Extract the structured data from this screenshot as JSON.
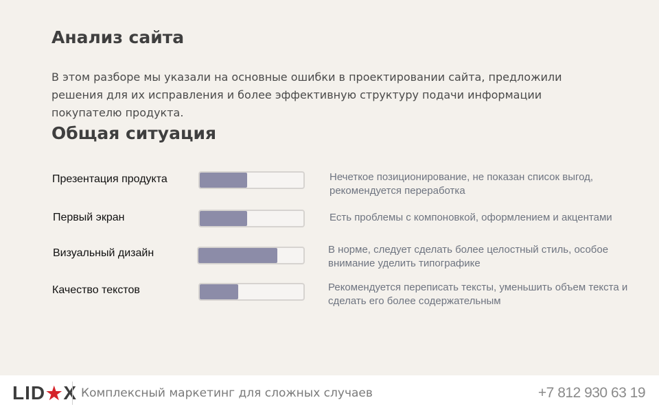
{
  "page": {
    "title": "Анализ сайта",
    "intro": "В этом разборе мы указали на основные ошибки в проектировании сайта, предложили решения для их исправления и более эффективную структуру подачи информации покупателю продукта.",
    "subtitle": "Общая ситуация"
  },
  "rows": [
    {
      "label": "Презентация продукта",
      "score": 0.46,
      "comment": "Нечеткое позиционирование, не показан список выгод, рекомендуется переработка"
    },
    {
      "label": "Первый экран",
      "score": 0.46,
      "comment": "Есть проблемы с компоновкой, оформлением и акцентами"
    },
    {
      "label": "Визуальный дизайн",
      "score": 0.75,
      "comment": "В норме, следует сделать более целостный стиль, особое внимание уделить типографике"
    },
    {
      "label": "Качество текстов",
      "score": 0.37,
      "comment": "Рекомендуется переписать тексты, уменьшить объем текста и сделать его более содержательным"
    }
  ],
  "footer": {
    "logo_left": "LID",
    "logo_right": "X",
    "tagline": "Комплексный маркетинг для сложных случаев",
    "phone": "+7 812 930 63 19"
  },
  "colors": {
    "bar_fill": "#8c8ca8",
    "logo_star": "#d5232a",
    "background": "#f4f1ec"
  }
}
